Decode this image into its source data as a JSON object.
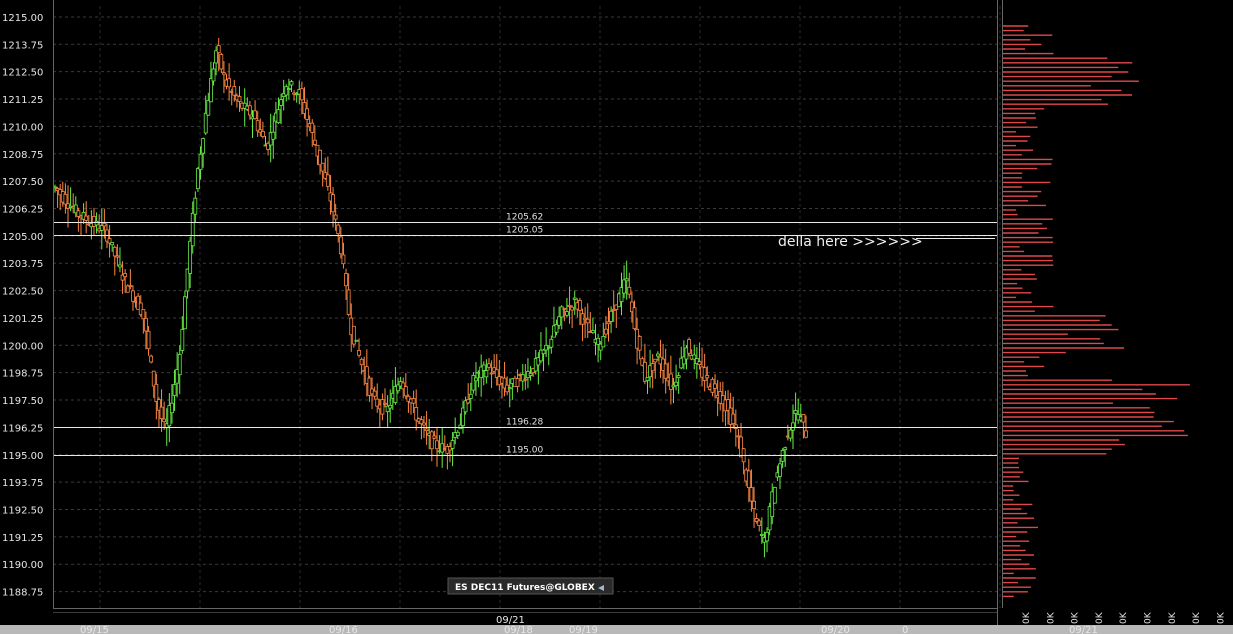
{
  "chart_data": {
    "type": "candlestick",
    "instrument": "ES DEC11 Futures@GLOBEX",
    "ylim": [
      1188.0,
      1215.5
    ],
    "y_ticks": [
      "1215.00",
      "1213.75",
      "1212.50",
      "1211.25",
      "1210.00",
      "1208.75",
      "1207.50",
      "1206.25",
      "1205.00",
      "1203.75",
      "1202.50",
      "1201.25",
      "1200.00",
      "1198.75",
      "1197.50",
      "1196.25",
      "1195.00",
      "1193.75",
      "1192.50",
      "1191.25",
      "1190.00",
      "1188.75"
    ],
    "grid": true,
    "x_labels_bottom": [
      "09/15",
      "09/16",
      "09/18",
      "09/19",
      "09/20",
      "0"
    ],
    "x_label_top": "09/21",
    "horizontal_lines": [
      {
        "value": 1205.62,
        "label": "1205.62"
      },
      {
        "value": 1205.05,
        "label": "1205.05"
      },
      {
        "value": 1196.28,
        "label": "1196.28"
      },
      {
        "value": 1195.0,
        "label": "1195.00"
      }
    ],
    "annotation": "della here >>>>>>",
    "up_color": "#66ee44",
    "down_color": "#ff8844",
    "bar_count": 290,
    "price_path": [
      [
        0,
        1207.2
      ],
      [
        10,
        1206.0
      ],
      [
        22,
        1205.2
      ],
      [
        30,
        1203.0
      ],
      [
        38,
        1201.5
      ],
      [
        44,
        1197.5
      ],
      [
        48,
        1196.0
      ],
      [
        54,
        1199.5
      ],
      [
        58,
        1204.0
      ],
      [
        62,
        1208.0
      ],
      [
        66,
        1211.0
      ],
      [
        70,
        1213.5
      ],
      [
        74,
        1212.0
      ],
      [
        80,
        1211.0
      ],
      [
        86,
        1210.5
      ],
      [
        92,
        1209.0
      ],
      [
        100,
        1212.0
      ],
      [
        106,
        1211.5
      ],
      [
        112,
        1209.5
      ],
      [
        116,
        1208.0
      ],
      [
        120,
        1206.5
      ],
      [
        124,
        1204.5
      ],
      [
        128,
        1201.0
      ],
      [
        132,
        1199.5
      ],
      [
        138,
        1197.5
      ],
      [
        144,
        1197.0
      ],
      [
        150,
        1198.5
      ],
      [
        158,
        1196.5
      ],
      [
        164,
        1195.5
      ],
      [
        170,
        1195.2
      ],
      [
        176,
        1196.5
      ],
      [
        182,
        1198.5
      ],
      [
        188,
        1199.0
      ],
      [
        196,
        1198.0
      ],
      [
        202,
        1198.5
      ],
      [
        208,
        1199.0
      ],
      [
        214,
        1200.0
      ],
      [
        220,
        1201.5
      ],
      [
        226,
        1202.0
      ],
      [
        230,
        1201.0
      ],
      [
        236,
        1200.0
      ],
      [
        242,
        1201.5
      ],
      [
        248,
        1203.0
      ],
      [
        252,
        1200.5
      ],
      [
        256,
        1198.5
      ],
      [
        262,
        1199.5
      ],
      [
        268,
        1198.0
      ],
      [
        274,
        1200.0
      ],
      [
        282,
        1198.5
      ],
      [
        290,
        1197.5
      ],
      [
        296,
        1196.0
      ],
      [
        300,
        1194.0
      ],
      [
        304,
        1192.0
      ],
      [
        308,
        1191.0
      ],
      [
        312,
        1193.5
      ],
      [
        318,
        1196.0
      ],
      [
        322,
        1197.0
      ],
      [
        326,
        1196.0
      ]
    ],
    "volume_profile_max_length": 0.9,
    "volume_profile_axis_labels": [
      "0K",
      "0K",
      "0K",
      "0K",
      "0K",
      "0K",
      "0K",
      "0K",
      "0K",
      "0K"
    ],
    "volume_profile_date": "09/21"
  }
}
